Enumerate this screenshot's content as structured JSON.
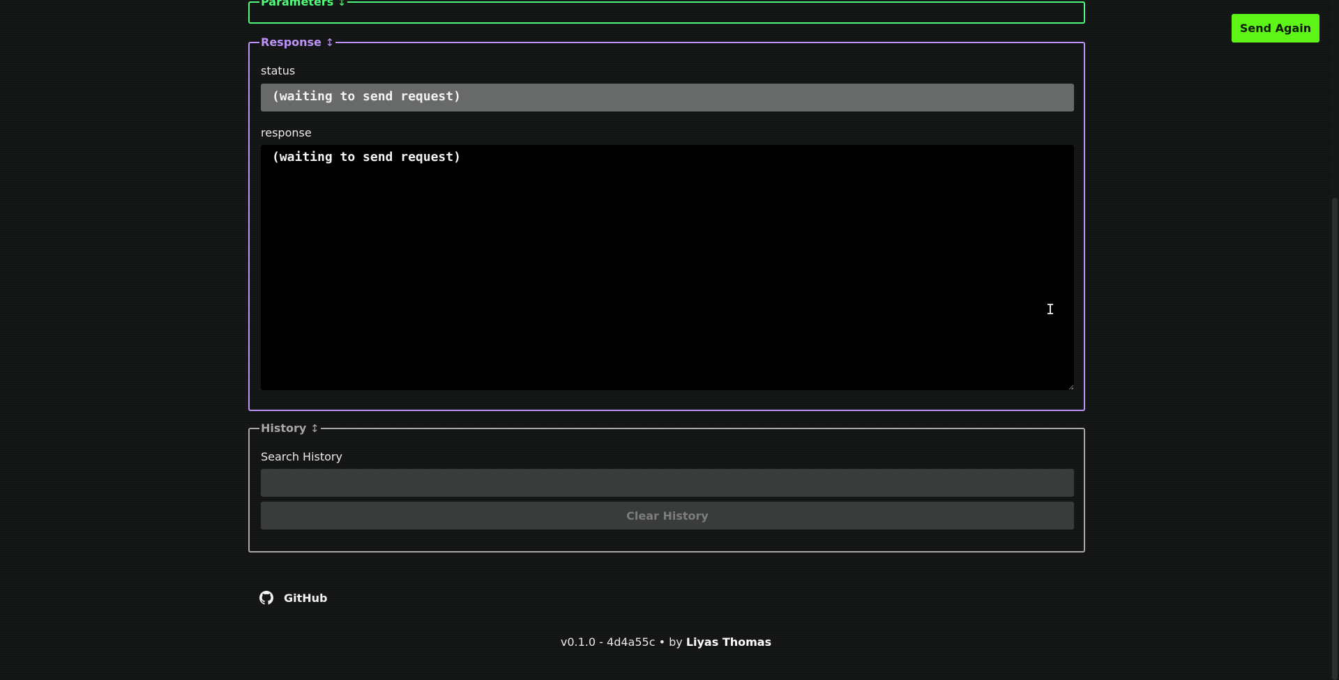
{
  "parameters": {
    "legend": "Parameters",
    "arrow": "↕"
  },
  "response": {
    "legend": "Response",
    "arrow": "↕",
    "status_label": "status",
    "status_value": "(waiting to send request)",
    "response_label": "response",
    "response_value": "(waiting to send request)"
  },
  "history": {
    "legend": "History",
    "arrow": "↕",
    "search_label": "Search History",
    "search_value": "",
    "clear_label": "Clear History"
  },
  "toolbar": {
    "send_again_label": "Send Again"
  },
  "footer": {
    "github_label": "GitHub",
    "version_text": "v0.1.0 - 4d4a55c • by ",
    "author": "Liyas Thomas"
  },
  "colors": {
    "parameters_accent": "#50fa7b",
    "response_accent": "#bd93f9",
    "history_accent": "#a8a8a8",
    "send_button": "#5cf517"
  },
  "icons": [
    "updown-arrow-icon",
    "github-icon",
    "resize-grip-icon",
    "text-cursor-icon"
  ]
}
